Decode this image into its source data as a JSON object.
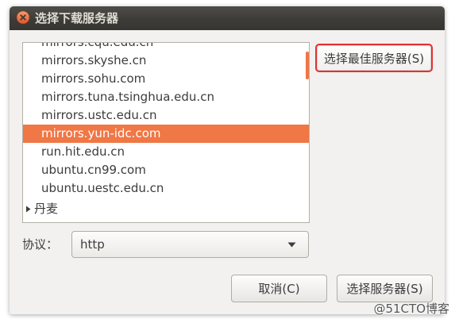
{
  "window": {
    "title": "选择下载服务器",
    "close_icon": "close-icon"
  },
  "server_list": {
    "items": [
      {
        "label": "mirrors.cqu.edu.cn",
        "selected": false
      },
      {
        "label": "mirrors.skyshe.cn",
        "selected": false
      },
      {
        "label": "mirrors.sohu.com",
        "selected": false
      },
      {
        "label": "mirrors.tuna.tsinghua.edu.cn",
        "selected": false
      },
      {
        "label": "mirrors.ustc.edu.cn",
        "selected": false
      },
      {
        "label": "mirrors.yun-idc.com",
        "selected": true
      },
      {
        "label": "run.hit.edu.cn",
        "selected": false
      },
      {
        "label": "ubuntu.cn99.com",
        "selected": false
      },
      {
        "label": "ubuntu.uestc.edu.cn",
        "selected": false
      }
    ],
    "group": {
      "label": "丹麦",
      "expanded": false,
      "expander_icon": "triangle-right-icon"
    }
  },
  "best_server_button": {
    "label": "选择最佳服务器(S)",
    "highlighted": true
  },
  "protocol": {
    "label": "协议：",
    "value": "http",
    "dropdown_icon": "chevron-down-icon"
  },
  "dialog_buttons": {
    "cancel": "取消(C)",
    "select_server": "选择服务器(S)"
  },
  "watermark": "@51CTO博客",
  "colors": {
    "accent": "#f07746",
    "annotation": "#e3302f",
    "titlebar": "#3c3b37",
    "dialog_background": "#f2f1f0"
  }
}
